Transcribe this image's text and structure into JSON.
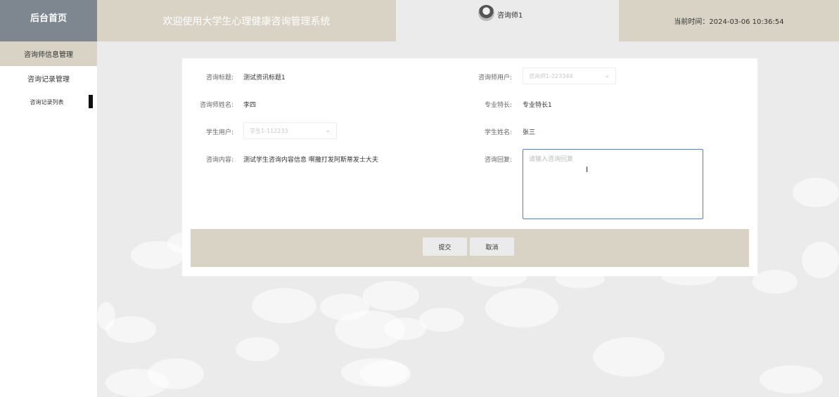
{
  "header": {
    "home_label": "后台首页",
    "system_title": "欢迎使用大学生心理健康咨询管理系统",
    "username": "咨询师1",
    "current_time": "当前时间：2024-03-06 10:36:54"
  },
  "sidebar": {
    "items": [
      {
        "label": "咨询师信息管理",
        "active": true
      },
      {
        "label": "咨询记录管理",
        "active": false
      }
    ],
    "sub_items": [
      {
        "label": "咨询记录列表",
        "active": true
      }
    ]
  },
  "form": {
    "title_label": "咨询标题:",
    "title_value": "测试资讯标题1",
    "counselor_user_label": "咨询师用户:",
    "counselor_user_value": "咨询师1-223344",
    "counselor_name_label": "咨询师姓名:",
    "counselor_name_value": "李四",
    "specialty_label": "专业特长:",
    "specialty_value": "专业特长1",
    "student_user_label": "学生用户:",
    "student_user_value": "学生1-112233",
    "student_name_label": "学生姓名:",
    "student_name_value": "张三",
    "content_label": "咨询内容:",
    "content_value": "测试学生咨询内容信息 啊撒打发阿斯蒂发士大夫",
    "reply_label": "咨询回复:",
    "reply_placeholder": "请输入咨询回复",
    "submit_label": "提交",
    "cancel_label": "取消"
  },
  "colors": {
    "logo_bg": "#7e868f",
    "header_bg": "#d8d3c5",
    "accent_border": "#4a7fd3"
  }
}
